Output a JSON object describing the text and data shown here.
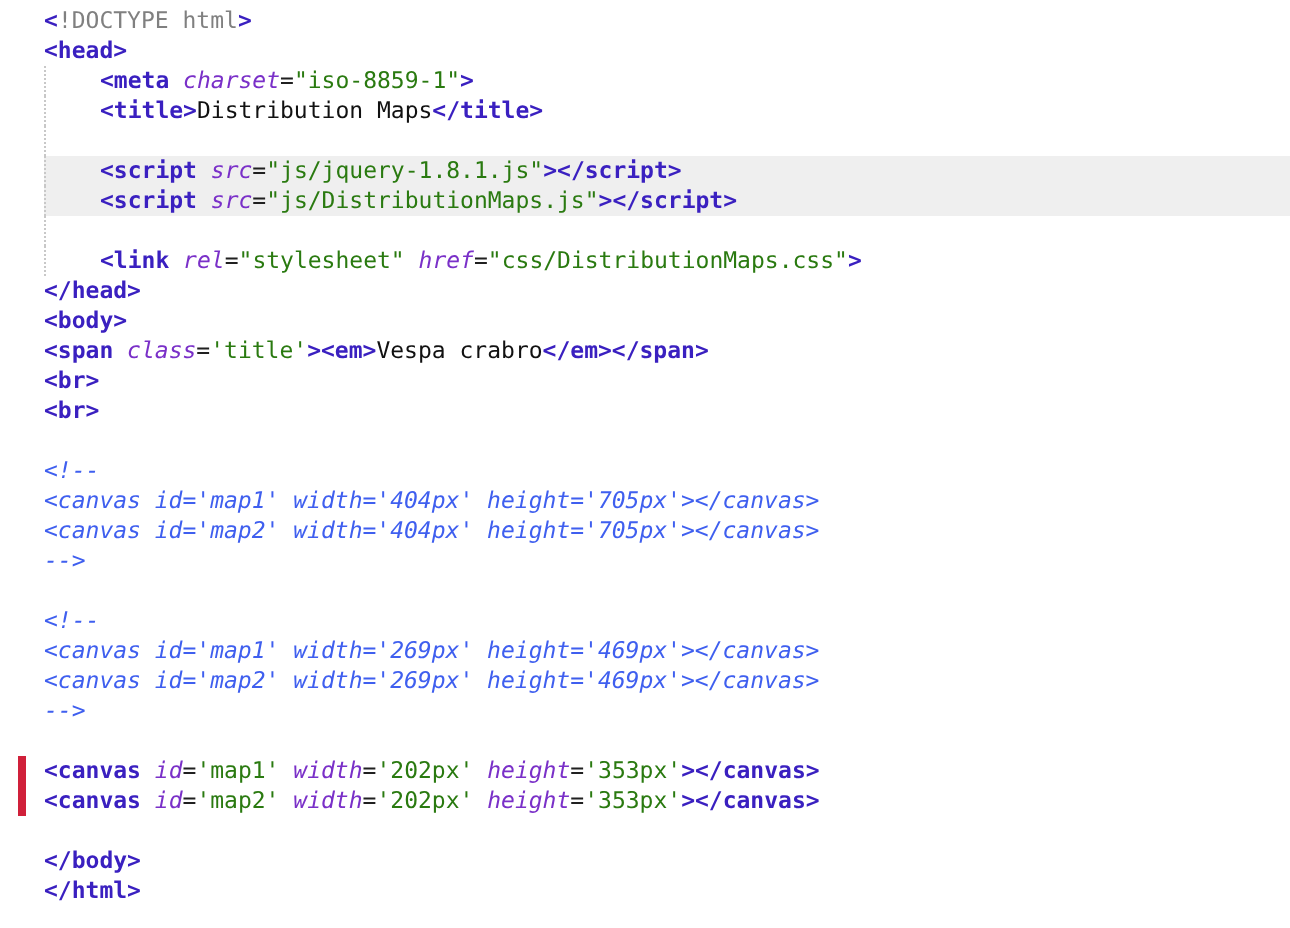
{
  "lines": [
    {
      "highlighted": false,
      "changed": false,
      "tokens": [
        {
          "kind": "tag",
          "text": "<"
        },
        {
          "kind": "doctype",
          "text": "!DOCTYPE html"
        },
        {
          "kind": "tag",
          "text": ">"
        }
      ]
    },
    {
      "highlighted": false,
      "changed": false,
      "tokens": [
        {
          "kind": "tag",
          "text": "<head>"
        }
      ],
      "children": [
        {
          "highlighted": false,
          "changed": false,
          "tokens": [
            {
              "kind": "tag",
              "text": "<meta"
            },
            {
              "kind": "attr",
              "text": " charset"
            },
            {
              "kind": "punct",
              "text": "="
            },
            {
              "kind": "value",
              "text": "\"iso-8859-1\""
            },
            {
              "kind": "tag",
              "text": ">"
            }
          ]
        },
        {
          "highlighted": false,
          "changed": false,
          "tokens": [
            {
              "kind": "tag",
              "text": "<title>"
            },
            {
              "kind": "text",
              "text": "Distribution Maps"
            },
            {
              "kind": "tag",
              "text": "</title>"
            }
          ]
        },
        {
          "highlighted": false,
          "changed": false
        },
        {
          "highlighted": true,
          "changed": false,
          "tokens": [
            {
              "kind": "tag",
              "text": "<script"
            },
            {
              "kind": "attr",
              "text": " src"
            },
            {
              "kind": "punct",
              "text": "="
            },
            {
              "kind": "value",
              "text": "\"js/jquery-1.8.1.js\""
            },
            {
              "kind": "tag",
              "text": "></script>"
            }
          ]
        },
        {
          "highlighted": true,
          "changed": false,
          "tokens": [
            {
              "kind": "tag",
              "text": "<script"
            },
            {
              "kind": "attr",
              "text": " src"
            },
            {
              "kind": "punct",
              "text": "="
            },
            {
              "kind": "value",
              "text": "\"js/DistributionMaps.js\""
            },
            {
              "kind": "tag",
              "text": "></script>"
            }
          ]
        },
        {
          "highlighted": false,
          "changed": false
        },
        {
          "highlighted": false,
          "changed": false,
          "tokens": [
            {
              "kind": "tag",
              "text": "<link"
            },
            {
              "kind": "attr",
              "text": " rel"
            },
            {
              "kind": "punct",
              "text": "="
            },
            {
              "kind": "value",
              "text": "\"stylesheet\""
            },
            {
              "kind": "attr",
              "text": " href"
            },
            {
              "kind": "punct",
              "text": "="
            },
            {
              "kind": "value",
              "text": "\"css/DistributionMaps.css\""
            },
            {
              "kind": "tag",
              "text": ">"
            }
          ]
        }
      ]
    },
    {
      "highlighted": false,
      "changed": false,
      "tokens": [
        {
          "kind": "tag",
          "text": "</head>"
        }
      ]
    },
    {
      "highlighted": false,
      "changed": false,
      "tokens": [
        {
          "kind": "tag",
          "text": "<body>"
        }
      ]
    },
    {
      "highlighted": false,
      "changed": false,
      "tokens": [
        {
          "kind": "tag",
          "text": "<span"
        },
        {
          "kind": "attr",
          "text": " class"
        },
        {
          "kind": "punct",
          "text": "="
        },
        {
          "kind": "value",
          "text": "'title'"
        },
        {
          "kind": "tag",
          "text": "><em>"
        },
        {
          "kind": "text",
          "text": "Vespa crabro"
        },
        {
          "kind": "tag",
          "text": "</em></span>"
        }
      ]
    },
    {
      "highlighted": false,
      "changed": false,
      "tokens": [
        {
          "kind": "tag",
          "text": "<br>"
        }
      ]
    },
    {
      "highlighted": false,
      "changed": false,
      "tokens": [
        {
          "kind": "tag",
          "text": "<br>"
        }
      ]
    },
    {
      "highlighted": false,
      "changed": false
    },
    {
      "highlighted": false,
      "changed": false,
      "tokens": [
        {
          "kind": "comment",
          "text": "<!--"
        }
      ]
    },
    {
      "highlighted": false,
      "changed": false,
      "tokens": [
        {
          "kind": "comment",
          "text": "<canvas id='map1' width='404px' height='705px'></canvas>"
        }
      ]
    },
    {
      "highlighted": false,
      "changed": false,
      "tokens": [
        {
          "kind": "comment",
          "text": "<canvas id='map2' width='404px' height='705px'></canvas>"
        }
      ]
    },
    {
      "highlighted": false,
      "changed": false,
      "tokens": [
        {
          "kind": "comment",
          "text": "-->"
        }
      ]
    },
    {
      "highlighted": false,
      "changed": false
    },
    {
      "highlighted": false,
      "changed": false,
      "tokens": [
        {
          "kind": "comment",
          "text": "<!--"
        }
      ]
    },
    {
      "highlighted": false,
      "changed": false,
      "tokens": [
        {
          "kind": "comment",
          "text": "<canvas id='map1' width='269px' height='469px'></canvas>"
        }
      ]
    },
    {
      "highlighted": false,
      "changed": false,
      "tokens": [
        {
          "kind": "comment",
          "text": "<canvas id='map2' width='269px' height='469px'></canvas>"
        }
      ]
    },
    {
      "highlighted": false,
      "changed": false,
      "tokens": [
        {
          "kind": "comment",
          "text": "-->"
        }
      ]
    },
    {
      "highlighted": false,
      "changed": false
    },
    {
      "highlighted": false,
      "changed": true,
      "tokens": [
        {
          "kind": "tag",
          "text": "<canvas"
        },
        {
          "kind": "attr",
          "text": " id"
        },
        {
          "kind": "punct",
          "text": "="
        },
        {
          "kind": "value",
          "text": "'map1'"
        },
        {
          "kind": "attr",
          "text": " width"
        },
        {
          "kind": "punct",
          "text": "="
        },
        {
          "kind": "value",
          "text": "'202px'"
        },
        {
          "kind": "attr",
          "text": " height"
        },
        {
          "kind": "punct",
          "text": "="
        },
        {
          "kind": "value",
          "text": "'353px'"
        },
        {
          "kind": "tag",
          "text": "></canvas>"
        }
      ]
    },
    {
      "highlighted": false,
      "changed": true,
      "tokens": [
        {
          "kind": "tag",
          "text": "<canvas"
        },
        {
          "kind": "attr",
          "text": " id"
        },
        {
          "kind": "punct",
          "text": "="
        },
        {
          "kind": "value",
          "text": "'map2'"
        },
        {
          "kind": "attr",
          "text": " width"
        },
        {
          "kind": "punct",
          "text": "="
        },
        {
          "kind": "value",
          "text": "'202px'"
        },
        {
          "kind": "attr",
          "text": " height"
        },
        {
          "kind": "punct",
          "text": "="
        },
        {
          "kind": "value",
          "text": "'353px'"
        },
        {
          "kind": "tag",
          "text": "></canvas>"
        }
      ]
    },
    {
      "highlighted": false,
      "changed": false
    },
    {
      "highlighted": false,
      "changed": false,
      "tokens": [
        {
          "kind": "tag",
          "text": "</body>"
        }
      ]
    },
    {
      "highlighted": false,
      "changed": false,
      "tokens": [
        {
          "kind": "tag",
          "text": "</html>"
        }
      ]
    }
  ]
}
